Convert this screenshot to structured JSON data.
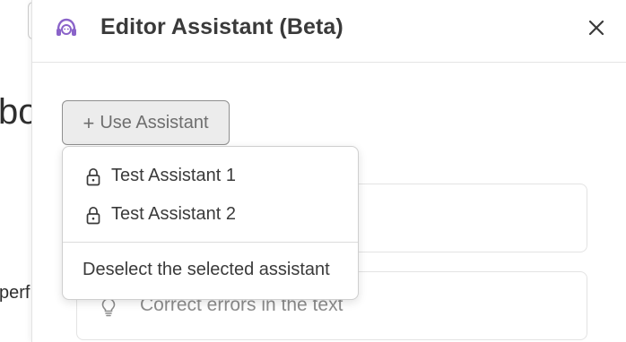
{
  "background": {
    "big_text_fragment": "bo",
    "small_text_fragment": "perf"
  },
  "panel": {
    "title": "Editor Assistant (Beta)",
    "icon": "assistant-headset-icon",
    "close_icon": "close-icon",
    "use_assistant_label": "Use Assistant",
    "use_assistant_icon": "plus-icon"
  },
  "dropdown": {
    "items": [
      {
        "label": "Test Assistant 1",
        "icon": "lock-icon"
      },
      {
        "label": "Test Assistant 2",
        "icon": "lock-icon"
      }
    ],
    "deselect_label": "Deselect the selected assistant"
  },
  "cards": [
    {
      "text": ""
    },
    {
      "text": "Correct errors in the text",
      "icon": "lightbulb-icon"
    }
  ],
  "colors": {
    "accent": "#8a63c9",
    "text": "#3a3a3a",
    "muted": "#8c8c8c"
  }
}
